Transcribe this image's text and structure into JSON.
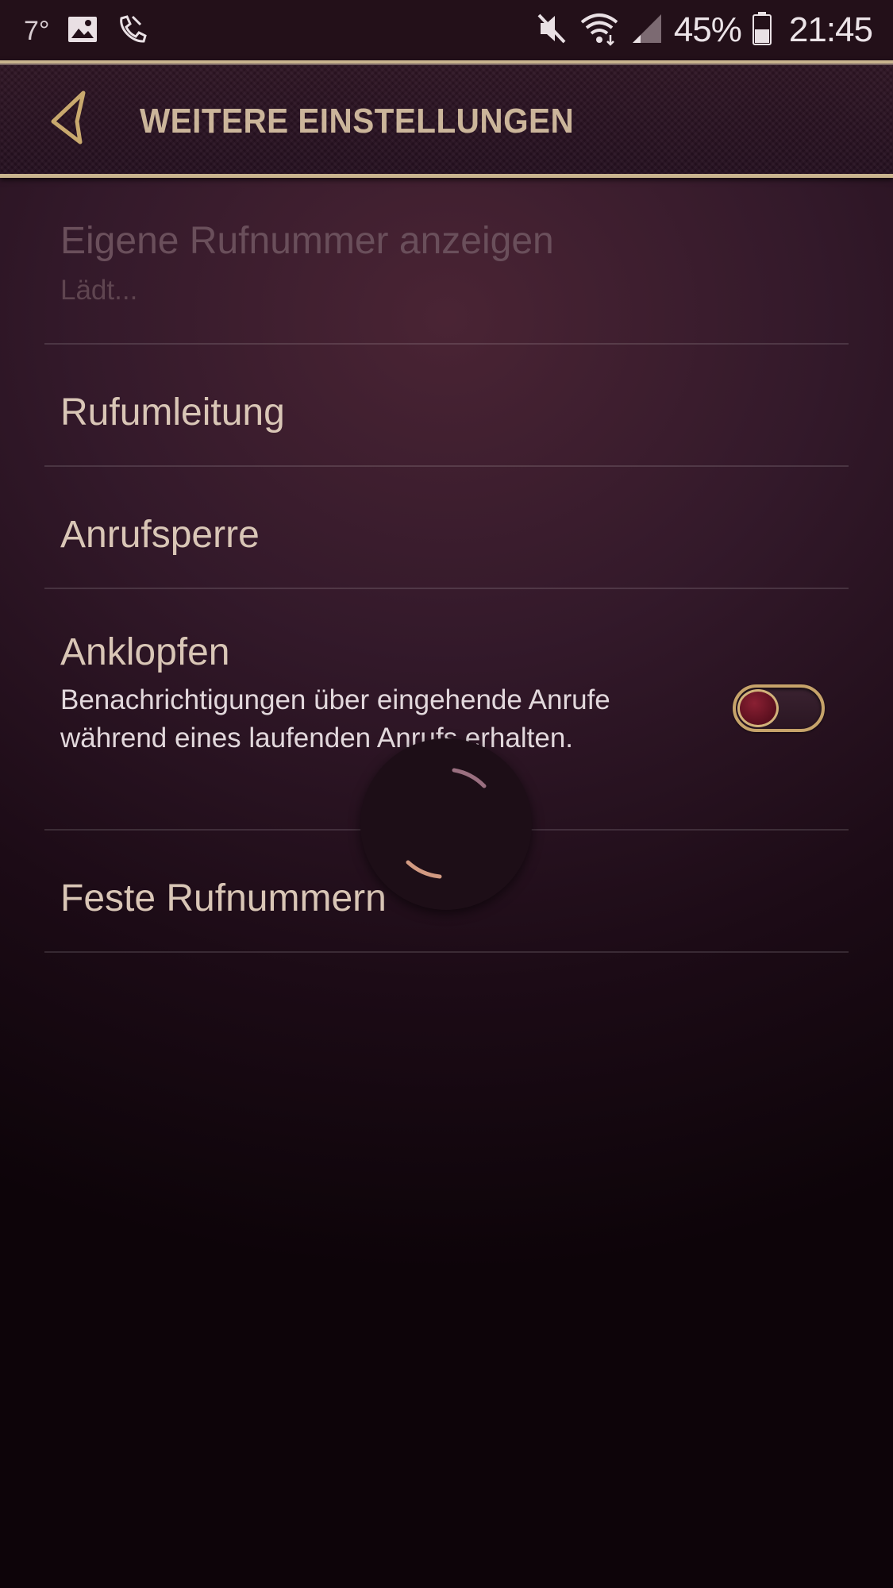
{
  "status_bar": {
    "temperature": "7°",
    "battery": "45%",
    "time": "21:45",
    "icons": [
      "image-icon",
      "call-settings-icon",
      "mute-icon",
      "wifi-icon",
      "signal-icon",
      "battery-icon"
    ]
  },
  "header": {
    "title": "WEITERE EINSTELLUNGEN",
    "back_icon": "back-triangle-icon"
  },
  "settings": {
    "own_number": {
      "title": "Eigene Rufnummer anzeigen",
      "subtitle": "Lädt..."
    },
    "forwarding": {
      "title": "Rufumleitung"
    },
    "barring": {
      "title": "Anrufsperre"
    },
    "waiting": {
      "title": "Anklopfen",
      "subtitle": "Benachrichtigungen über eingehende Anrufe während eines laufenden Anrufs erhalten.",
      "toggle_on": false
    },
    "fixed_numbers": {
      "title": "Feste Rufnummern"
    }
  },
  "colors": {
    "accent_gold": "#c9b48e",
    "title_text": "#d9c6b6",
    "background": "#33192a"
  },
  "loading_indicator": "spinner-icon"
}
